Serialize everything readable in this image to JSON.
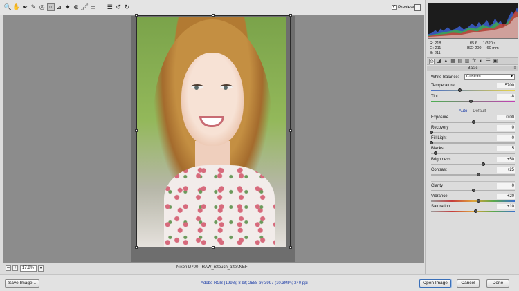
{
  "toolbar": {
    "tools": [
      {
        "icon": "zoom-tool-icon",
        "glyph": "🔍"
      },
      {
        "icon": "hand-tool-icon",
        "glyph": "✋"
      },
      {
        "icon": "white-balance-tool-icon",
        "glyph": "✒"
      },
      {
        "icon": "color-sampler-tool-icon",
        "glyph": "✎"
      },
      {
        "icon": "targeted-adjustment-tool-icon",
        "glyph": "◎"
      },
      {
        "icon": "crop-tool-icon",
        "glyph": "⌗"
      },
      {
        "icon": "straighten-tool-icon",
        "glyph": "⊿"
      },
      {
        "icon": "spot-removal-tool-icon",
        "glyph": "✦"
      },
      {
        "icon": "red-eye-tool-icon",
        "glyph": "⊛"
      },
      {
        "icon": "adjustment-brush-icon",
        "glyph": "🖌"
      },
      {
        "icon": "graduated-filter-icon",
        "glyph": "▭"
      },
      {
        "icon": "preferences-icon",
        "glyph": "☰"
      },
      {
        "icon": "rotate-left-icon",
        "glyph": "↺"
      },
      {
        "icon": "rotate-right-icon",
        "glyph": "↻"
      }
    ],
    "active_tool_index": 5,
    "preview_label": "Preview",
    "preview_checked": true
  },
  "canvas": {
    "zoom_value": "17.8%",
    "zoom_minus": "–",
    "zoom_plus": "+",
    "filename": "Nikon D700 - RAW_retouch_after.NEF"
  },
  "readout": {
    "r": "R:  218",
    "g": "G:  211",
    "b": "B:  211",
    "aperture": "f/5.6",
    "shutter": "1/320 s",
    "iso": "ISO 200",
    "focal": "60 mm"
  },
  "panel": {
    "tabs": [
      "basic-tab-icon",
      "tone-curve-tab-icon",
      "detail-tab-icon",
      "hsl-tab-icon",
      "split-toning-tab-icon",
      "lens-tab-icon",
      "fx-tab-icon",
      "camera-calibration-tab-icon",
      "presets-tab-icon",
      "snapshots-tab-icon"
    ],
    "tab_glyphs": [
      "⊙",
      "◢",
      "▲",
      "▦",
      "▤",
      "▥",
      "fx",
      "◐",
      "☰",
      "▣"
    ],
    "section_title": "Basic",
    "white_balance_label": "White Balance:",
    "white_balance_value": "Custom",
    "auto_label": "Auto",
    "default_label": "Default",
    "sliders": [
      {
        "label": "Temperature",
        "value": "5700",
        "fraction": 0.34,
        "gradient": "linear-gradient(90deg,#4a72c8,#e9d44a)"
      },
      {
        "label": "Tint",
        "value": "-8",
        "fraction": 0.47,
        "gradient": "linear-gradient(90deg,#4caf50,#c43fb5)"
      },
      {
        "label": "Exposure",
        "value": "0.00",
        "fraction": 0.5,
        "gradient": ""
      },
      {
        "label": "Recovery",
        "value": "0",
        "fraction": 0.0,
        "gradient": ""
      },
      {
        "label": "Fill Light",
        "value": "0",
        "fraction": 0.0,
        "gradient": ""
      },
      {
        "label": "Blacks",
        "value": "5",
        "fraction": 0.05,
        "gradient": ""
      },
      {
        "label": "Brightness",
        "value": "+50",
        "fraction": 0.62,
        "gradient": ""
      },
      {
        "label": "Contrast",
        "value": "+25",
        "fraction": 0.56,
        "gradient": ""
      },
      {
        "label": "Clarity",
        "value": "0",
        "fraction": 0.5,
        "gradient": ""
      },
      {
        "label": "Vibrance",
        "value": "+20",
        "fraction": 0.56,
        "gradient": "linear-gradient(90deg,#9a9a9a,#c63d3d,#e0a23a,#5aa84a,#3a6fd0)"
      },
      {
        "label": "Saturation",
        "value": "+10",
        "fraction": 0.53,
        "gradient": "linear-gradient(90deg,#9a9a9a,#c63d3d,#e0a23a,#5aa84a,#3a6fd0)"
      }
    ]
  },
  "bottom": {
    "save_label": "Save Image...",
    "workflow_text": "Adobe RGB (1998); 8 bit; 2588 by 3997 (10.3MP); 240 ppi",
    "open_label": "Open Image",
    "cancel_label": "Cancel",
    "done_label": "Done"
  }
}
